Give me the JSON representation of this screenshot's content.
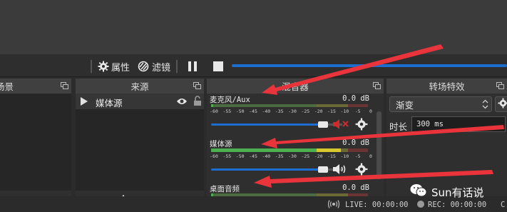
{
  "toolbar": {
    "properties_label": "属性",
    "filters_label": "滤镜",
    "icons": [
      "gear-icon",
      "filter-icon",
      "pause-icon",
      "stop-icon"
    ]
  },
  "docks": {
    "scenes_title": "场景",
    "sources_title": "来源",
    "mixer_title": "混音器",
    "transitions_title": "转场特效"
  },
  "sources": {
    "items": [
      {
        "label": "媒体源",
        "visible": true,
        "locked": false
      }
    ]
  },
  "mixer": {
    "channels": [
      {
        "name": "麦克风/Aux",
        "db": "0.0 dB",
        "muted": true
      },
      {
        "name": "媒体源",
        "db": "0.0 dB",
        "muted": false
      },
      {
        "name": "桌面音频",
        "db": "0.0 dB",
        "muted": false
      }
    ],
    "scale": [
      "-60",
      "-55",
      "-50",
      "-45",
      "-40",
      "-35",
      "-30",
      "-25",
      "-20",
      "-15",
      "-10",
      "-5",
      "0"
    ]
  },
  "transitions": {
    "selected": "渐变",
    "duration_label": "时长",
    "duration_value": "300 ms"
  },
  "status": {
    "live": "LIVE: 00:00:00",
    "rec": "REC: 00:00:00",
    "cpu_partial": "C"
  },
  "watermark": {
    "text": "Sun有话说"
  },
  "colors": {
    "accent": "#1b6dd0",
    "arrow": "#e8343a",
    "meter_green": "#4caf50",
    "meter_yellow": "#d8c830",
    "meter_red": "#c63030"
  }
}
